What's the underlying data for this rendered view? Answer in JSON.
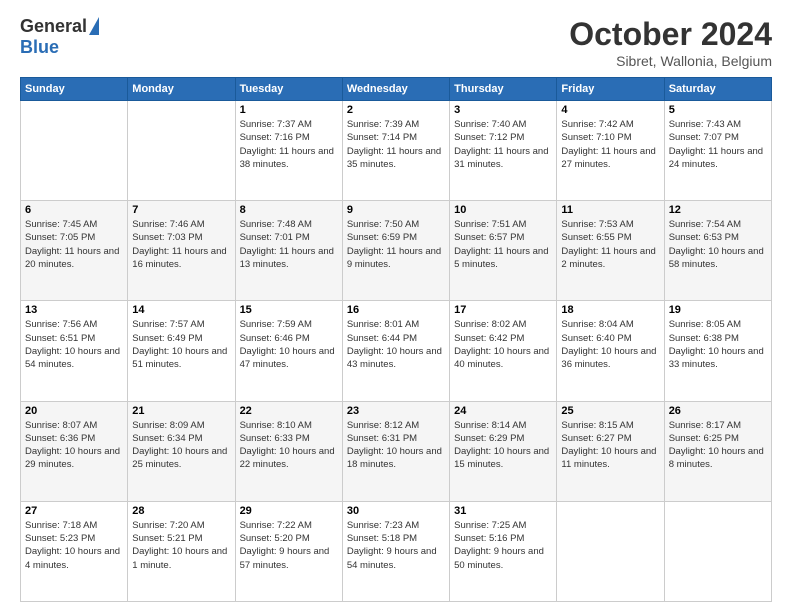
{
  "logo": {
    "general": "General",
    "blue": "Blue"
  },
  "header": {
    "month": "October 2024",
    "location": "Sibret, Wallonia, Belgium"
  },
  "days": [
    "Sunday",
    "Monday",
    "Tuesday",
    "Wednesday",
    "Thursday",
    "Friday",
    "Saturday"
  ],
  "weeks": [
    [
      {
        "day": "",
        "sunrise": "",
        "sunset": "",
        "daylight": ""
      },
      {
        "day": "",
        "sunrise": "",
        "sunset": "",
        "daylight": ""
      },
      {
        "day": "1",
        "sunrise": "Sunrise: 7:37 AM",
        "sunset": "Sunset: 7:16 PM",
        "daylight": "Daylight: 11 hours and 38 minutes."
      },
      {
        "day": "2",
        "sunrise": "Sunrise: 7:39 AM",
        "sunset": "Sunset: 7:14 PM",
        "daylight": "Daylight: 11 hours and 35 minutes."
      },
      {
        "day": "3",
        "sunrise": "Sunrise: 7:40 AM",
        "sunset": "Sunset: 7:12 PM",
        "daylight": "Daylight: 11 hours and 31 minutes."
      },
      {
        "day": "4",
        "sunrise": "Sunrise: 7:42 AM",
        "sunset": "Sunset: 7:10 PM",
        "daylight": "Daylight: 11 hours and 27 minutes."
      },
      {
        "day": "5",
        "sunrise": "Sunrise: 7:43 AM",
        "sunset": "Sunset: 7:07 PM",
        "daylight": "Daylight: 11 hours and 24 minutes."
      }
    ],
    [
      {
        "day": "6",
        "sunrise": "Sunrise: 7:45 AM",
        "sunset": "Sunset: 7:05 PM",
        "daylight": "Daylight: 11 hours and 20 minutes."
      },
      {
        "day": "7",
        "sunrise": "Sunrise: 7:46 AM",
        "sunset": "Sunset: 7:03 PM",
        "daylight": "Daylight: 11 hours and 16 minutes."
      },
      {
        "day": "8",
        "sunrise": "Sunrise: 7:48 AM",
        "sunset": "Sunset: 7:01 PM",
        "daylight": "Daylight: 11 hours and 13 minutes."
      },
      {
        "day": "9",
        "sunrise": "Sunrise: 7:50 AM",
        "sunset": "Sunset: 6:59 PM",
        "daylight": "Daylight: 11 hours and 9 minutes."
      },
      {
        "day": "10",
        "sunrise": "Sunrise: 7:51 AM",
        "sunset": "Sunset: 6:57 PM",
        "daylight": "Daylight: 11 hours and 5 minutes."
      },
      {
        "day": "11",
        "sunrise": "Sunrise: 7:53 AM",
        "sunset": "Sunset: 6:55 PM",
        "daylight": "Daylight: 11 hours and 2 minutes."
      },
      {
        "day": "12",
        "sunrise": "Sunrise: 7:54 AM",
        "sunset": "Sunset: 6:53 PM",
        "daylight": "Daylight: 10 hours and 58 minutes."
      }
    ],
    [
      {
        "day": "13",
        "sunrise": "Sunrise: 7:56 AM",
        "sunset": "Sunset: 6:51 PM",
        "daylight": "Daylight: 10 hours and 54 minutes."
      },
      {
        "day": "14",
        "sunrise": "Sunrise: 7:57 AM",
        "sunset": "Sunset: 6:49 PM",
        "daylight": "Daylight: 10 hours and 51 minutes."
      },
      {
        "day": "15",
        "sunrise": "Sunrise: 7:59 AM",
        "sunset": "Sunset: 6:46 PM",
        "daylight": "Daylight: 10 hours and 47 minutes."
      },
      {
        "day": "16",
        "sunrise": "Sunrise: 8:01 AM",
        "sunset": "Sunset: 6:44 PM",
        "daylight": "Daylight: 10 hours and 43 minutes."
      },
      {
        "day": "17",
        "sunrise": "Sunrise: 8:02 AM",
        "sunset": "Sunset: 6:42 PM",
        "daylight": "Daylight: 10 hours and 40 minutes."
      },
      {
        "day": "18",
        "sunrise": "Sunrise: 8:04 AM",
        "sunset": "Sunset: 6:40 PM",
        "daylight": "Daylight: 10 hours and 36 minutes."
      },
      {
        "day": "19",
        "sunrise": "Sunrise: 8:05 AM",
        "sunset": "Sunset: 6:38 PM",
        "daylight": "Daylight: 10 hours and 33 minutes."
      }
    ],
    [
      {
        "day": "20",
        "sunrise": "Sunrise: 8:07 AM",
        "sunset": "Sunset: 6:36 PM",
        "daylight": "Daylight: 10 hours and 29 minutes."
      },
      {
        "day": "21",
        "sunrise": "Sunrise: 8:09 AM",
        "sunset": "Sunset: 6:34 PM",
        "daylight": "Daylight: 10 hours and 25 minutes."
      },
      {
        "day": "22",
        "sunrise": "Sunrise: 8:10 AM",
        "sunset": "Sunset: 6:33 PM",
        "daylight": "Daylight: 10 hours and 22 minutes."
      },
      {
        "day": "23",
        "sunrise": "Sunrise: 8:12 AM",
        "sunset": "Sunset: 6:31 PM",
        "daylight": "Daylight: 10 hours and 18 minutes."
      },
      {
        "day": "24",
        "sunrise": "Sunrise: 8:14 AM",
        "sunset": "Sunset: 6:29 PM",
        "daylight": "Daylight: 10 hours and 15 minutes."
      },
      {
        "day": "25",
        "sunrise": "Sunrise: 8:15 AM",
        "sunset": "Sunset: 6:27 PM",
        "daylight": "Daylight: 10 hours and 11 minutes."
      },
      {
        "day": "26",
        "sunrise": "Sunrise: 8:17 AM",
        "sunset": "Sunset: 6:25 PM",
        "daylight": "Daylight: 10 hours and 8 minutes."
      }
    ],
    [
      {
        "day": "27",
        "sunrise": "Sunrise: 7:18 AM",
        "sunset": "Sunset: 5:23 PM",
        "daylight": "Daylight: 10 hours and 4 minutes."
      },
      {
        "day": "28",
        "sunrise": "Sunrise: 7:20 AM",
        "sunset": "Sunset: 5:21 PM",
        "daylight": "Daylight: 10 hours and 1 minute."
      },
      {
        "day": "29",
        "sunrise": "Sunrise: 7:22 AM",
        "sunset": "Sunset: 5:20 PM",
        "daylight": "Daylight: 9 hours and 57 minutes."
      },
      {
        "day": "30",
        "sunrise": "Sunrise: 7:23 AM",
        "sunset": "Sunset: 5:18 PM",
        "daylight": "Daylight: 9 hours and 54 minutes."
      },
      {
        "day": "31",
        "sunrise": "Sunrise: 7:25 AM",
        "sunset": "Sunset: 5:16 PM",
        "daylight": "Daylight: 9 hours and 50 minutes."
      },
      {
        "day": "",
        "sunrise": "",
        "sunset": "",
        "daylight": ""
      },
      {
        "day": "",
        "sunrise": "",
        "sunset": "",
        "daylight": ""
      }
    ]
  ]
}
